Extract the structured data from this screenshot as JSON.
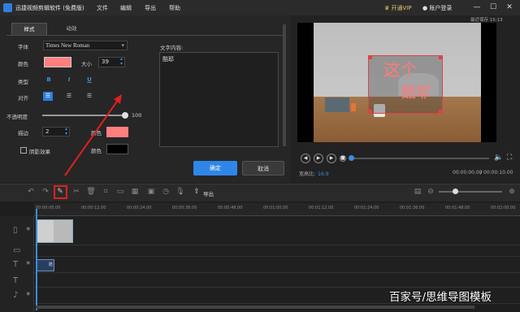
{
  "titlebar": {
    "title": "迅捷视频剪辑软件 (免费版)",
    "menu": [
      "文件",
      "编辑",
      "导出",
      "帮助"
    ],
    "vip": "开通VIP",
    "login": "账户登录",
    "min_glyph": "—",
    "max_glyph": "☐",
    "close_glyph": "✕"
  },
  "editor": {
    "tabs": [
      "样式",
      "动效"
    ],
    "font_label": "字体",
    "font_value": "Times New Roman",
    "color_label": "颜色",
    "size_label": "大小",
    "size_value": "39",
    "type_label": "类型",
    "type_buttons": [
      "B",
      "I",
      "U"
    ],
    "align_label": "对齐",
    "opacity_label": "不透明度",
    "opacity_value": "100",
    "stroke_label": "描边",
    "stroke_value": "2",
    "stroke_color_label": "颜色",
    "shadow_label": "阴影效果",
    "shadow_color_label": "颜色",
    "text_content_label": "文字内容:",
    "text_content_value": "酷耶",
    "ok": "确定",
    "cancel": "取消",
    "text_color": "#ff7f7f"
  },
  "preview": {
    "save_time": "最近保存 15:13",
    "overlay_line1": "这个",
    "overlay_line2": "酷耶",
    "ratio_label": "宽高比:",
    "ratio_value": "16:9",
    "time_current": "00:00:00.00",
    "time_separator": "/",
    "time_total": "00:00:10.00"
  },
  "toolbar": {
    "export_label": "导出"
  },
  "timeline": {
    "ticks": [
      "00:00:00.00",
      "00:00:12.00",
      "00:00:24.00",
      "00:00:36.00",
      "00:00:48.00",
      "00:01:00.00",
      "00:01:12.00",
      "00:01:24.00",
      "00:01:36.00",
      "00:01:48.00",
      "00:02:00.00"
    ],
    "text_clip": "酷"
  },
  "watermark": "百家号/思维导图模板",
  "colors": {
    "accent": "#2f86e8",
    "highlight_border": "#e02020"
  }
}
